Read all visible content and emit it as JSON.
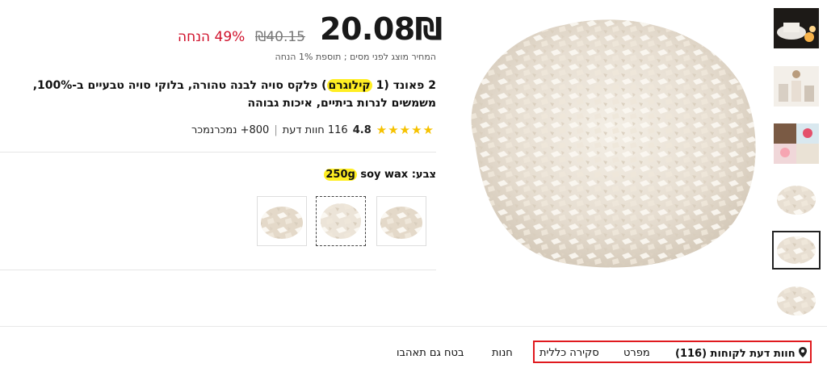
{
  "price": {
    "current": "20.08₪",
    "original": "₪40.15",
    "discount": "49% הנחה",
    "tax_note": "המחיר מוצג לפני מסים ; תוספת 1% הנחה"
  },
  "product": {
    "title_pre": "2 פאונד (1 ",
    "title_highlight": "קילוגרם",
    "title_post": ") פלקס סויה לבנה טהורה, בלוקי סויה טבעיים ב-100%, משמשים לנרות ביתיים, איכות גבוהה"
  },
  "rating": {
    "stars": "★★★★★",
    "score": "4.8",
    "reviews": "116 חוות דעת",
    "separator": "|",
    "sold": "800+ נמכרנמכר"
  },
  "variant": {
    "label_prefix": "צבע: ",
    "label_name": "soy wax ",
    "label_highlight": "250g"
  },
  "tabs": {
    "reviews": "חוות דעת לקוחות (116)",
    "specs": "מפרט",
    "overview": "סקירה כללית",
    "store": "חנות",
    "recommended": "בטח גם תאהבו"
  },
  "icons": {
    "pin": "map-pin-icon",
    "star": "star-icon"
  },
  "colors": {
    "accent_red": "#d0112b",
    "highlight": "#ffee22",
    "star": "#f6c200",
    "box": "#e0191e"
  }
}
